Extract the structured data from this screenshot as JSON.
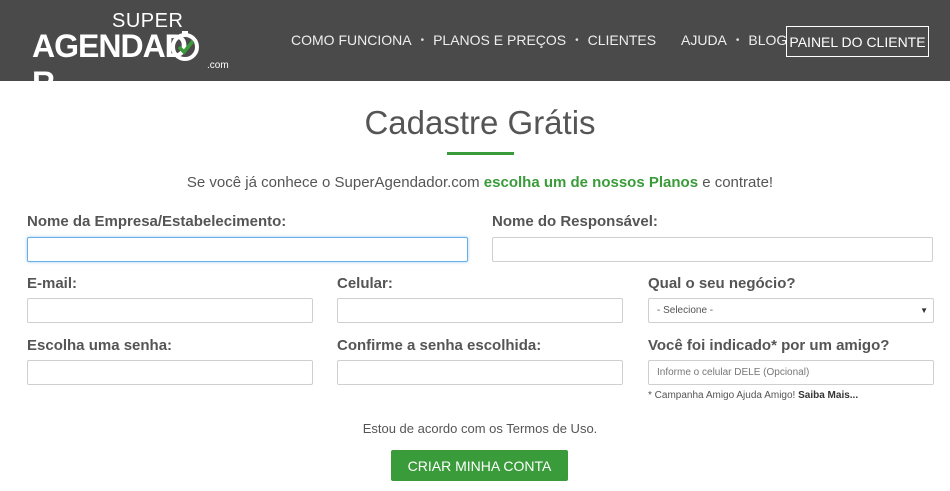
{
  "header": {
    "logo_super": "SUPER",
    "logo_main": "AGENDAD",
    "logo_tail": "R",
    "logo_com": ".com",
    "nav_left": [
      "COMO FUNCIONA",
      "PLANOS E PREÇOS",
      "CLIENTES"
    ],
    "nav_right": [
      "AJUDA",
      "BLOG"
    ],
    "panel_button": "PAINEL DO CLIENTE",
    "separator": "•"
  },
  "main": {
    "title": "Cadastre Grátis",
    "subtitle_prefix": "Se você já conhece o SuperAgendador.com ",
    "subtitle_link": "escolha um de nossos Planos",
    "subtitle_suffix": " e contrate!"
  },
  "form": {
    "company_label": "Nome da Empresa/Estabelecimento:",
    "company_value": "",
    "responsible_label": "Nome do Responsável:",
    "responsible_value": "",
    "email_label": "E-mail:",
    "email_value": "",
    "phone_label": "Celular:",
    "phone_value": "",
    "business_label": "Qual o seu negócio?",
    "business_selected": "- Selecione -",
    "password_label": "Escolha uma senha:",
    "password_value": "",
    "confirm_label": "Confirme a senha escolhida:",
    "confirm_value": "",
    "referral_label": "Você foi indicado* por um amigo?",
    "referral_placeholder": "Informe o celular DELE (Opcional)",
    "note_prefix": "* Campanha Amigo Ajuda Amigo! ",
    "note_link": "Saiba Mais...",
    "terms": "Estou de acordo com os Termos de Uso.",
    "submit": "CRIAR MINHA CONTA"
  },
  "colors": {
    "header_bg": "#4a4a4a",
    "accent_green": "#3a9b3a",
    "focus_blue": "#66afe9"
  }
}
